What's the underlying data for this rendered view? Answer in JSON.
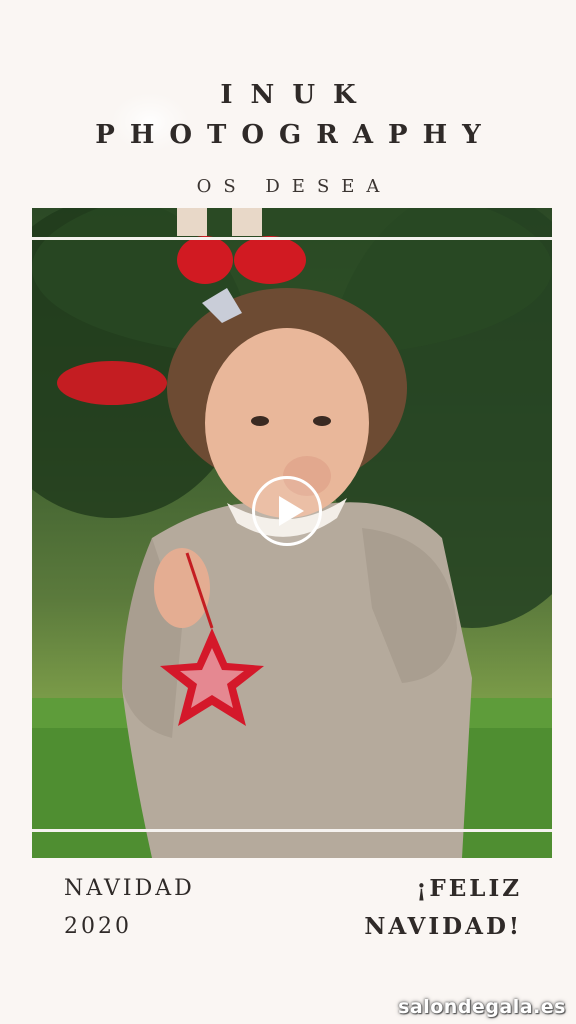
{
  "header": {
    "title_line1": "INUK",
    "title_line2": "PHOTOGRAPHY",
    "subtitle": "OS DESEA"
  },
  "footer": {
    "left_line1": "NAVIDAD",
    "left_line2": "2020",
    "right_line1": "¡FELIZ",
    "right_line2": "NAVIDAD!"
  },
  "watermark": "salondegala.es",
  "colors": {
    "background": "#faf6f3",
    "text": "#2f2a28",
    "accent_red": "#d4182a"
  },
  "icons": {
    "play": "play-icon"
  }
}
